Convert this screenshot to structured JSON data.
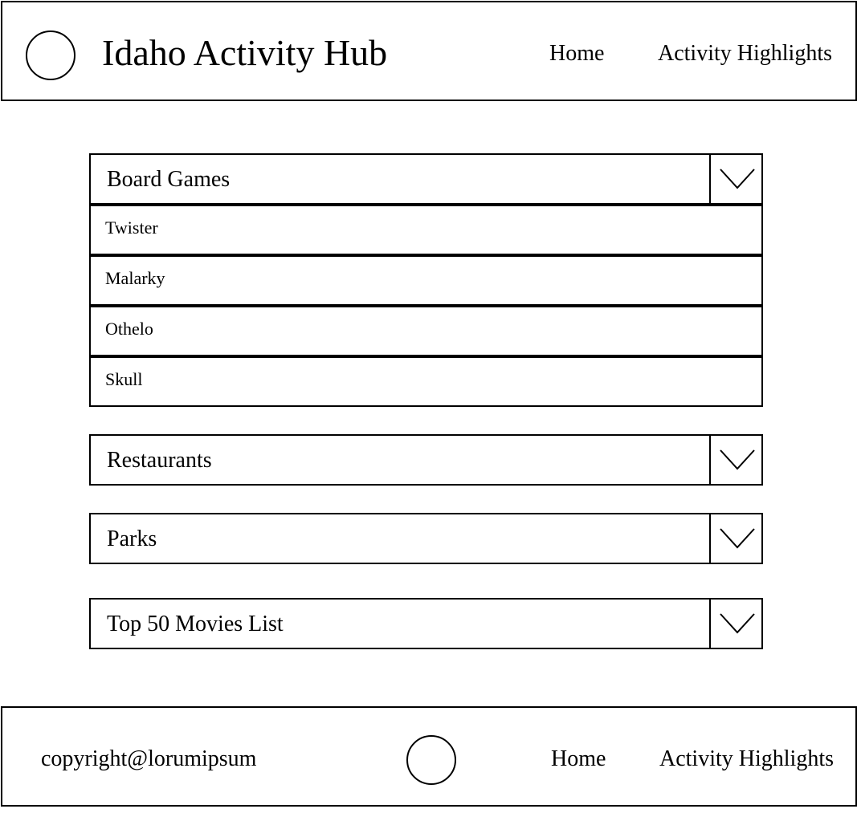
{
  "header": {
    "logo_icon": "circle-logo-icon",
    "title": "Idaho Activity Hub",
    "nav": {
      "home": "Home",
      "highlights": "Activity Highlights"
    }
  },
  "sections": [
    {
      "label": "Board Games",
      "expanded": true,
      "toggle_icon": "chevron-down-icon",
      "items": [
        "Twister",
        "Malarky",
        "Othelo",
        "Skull"
      ]
    },
    {
      "label": "Restaurants",
      "expanded": false,
      "toggle_icon": "chevron-down-icon"
    },
    {
      "label": "Parks",
      "expanded": false,
      "toggle_icon": "chevron-down-icon"
    },
    {
      "label": "Top 50 Movies List",
      "expanded": false,
      "toggle_icon": "chevron-down-icon"
    }
  ],
  "footer": {
    "copyright": "copyright@lorumipsum",
    "logo_icon": "circle-logo-icon",
    "nav": {
      "home": "Home",
      "highlights": "Activity Highlights"
    }
  }
}
